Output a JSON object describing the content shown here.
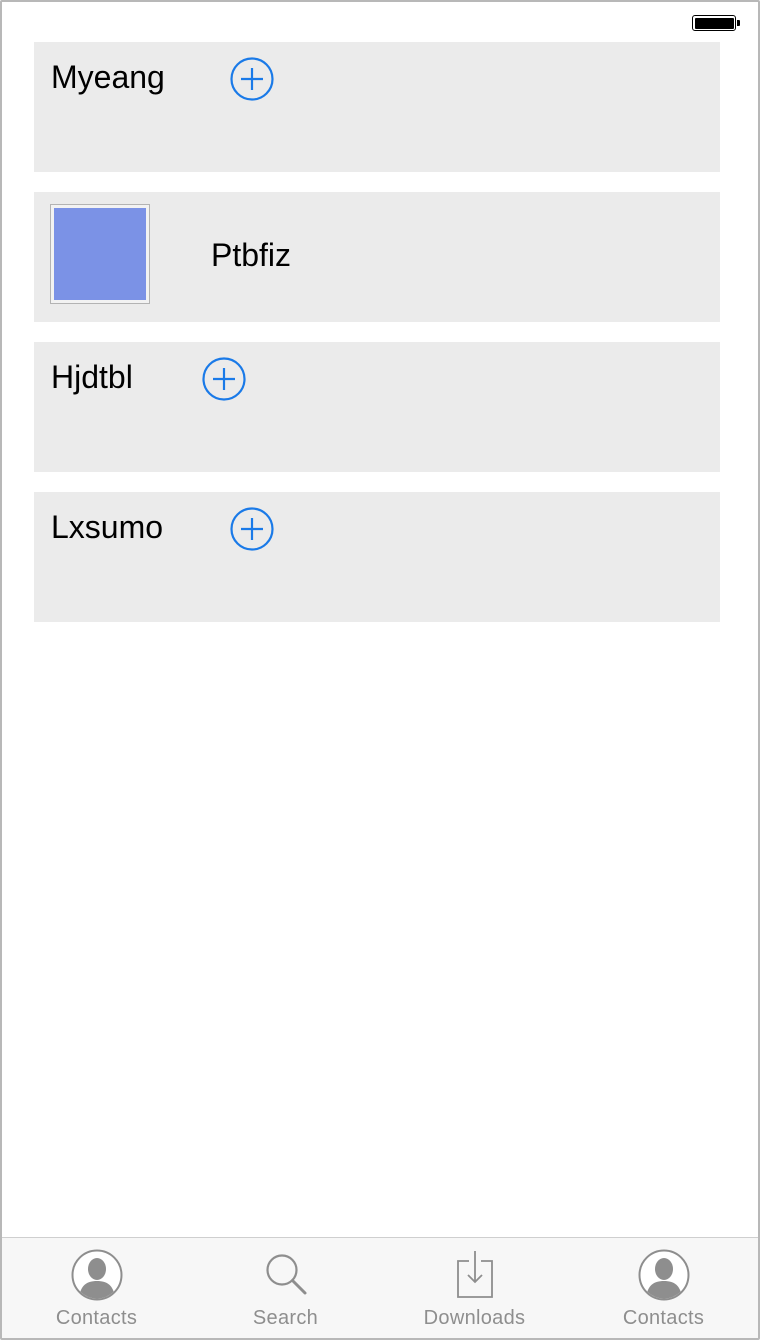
{
  "colors": {
    "accent": "#1a7ae8",
    "card_bg": "#ebebeb",
    "thumbnail": "#7b92e6",
    "tab_inactive": "#8e8e8e"
  },
  "cards": [
    {
      "title": "Myeang",
      "action_icon": "add-circle-icon"
    },
    {
      "thumbnail_label": "Ptbfiz",
      "thumbnail_color": "#7b92e6"
    },
    {
      "title": "Hjdtbl",
      "action_icon": "add-circle-icon"
    },
    {
      "title": "Lxsumo",
      "action_icon": "add-circle-icon"
    }
  ],
  "tabbar": {
    "tabs": [
      {
        "label": "Contacts",
        "icon": "contacts-icon"
      },
      {
        "label": "Search",
        "icon": "search-icon"
      },
      {
        "label": "Downloads",
        "icon": "downloads-icon"
      },
      {
        "label": "Contacts",
        "icon": "contacts-icon"
      }
    ]
  }
}
